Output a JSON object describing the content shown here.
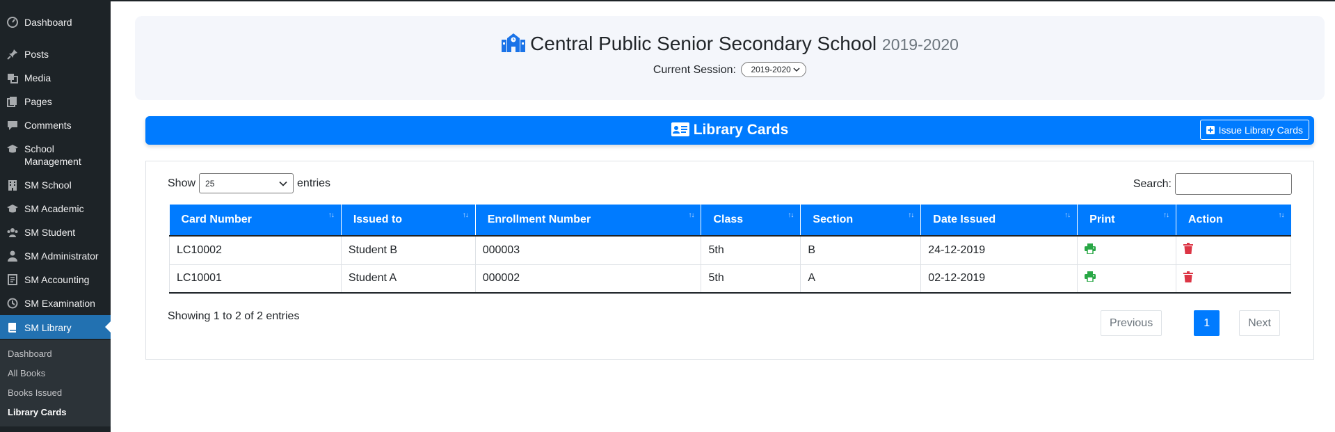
{
  "sidebar": {
    "items": [
      {
        "label": "Dashboard",
        "icon": "dashboard-icon"
      },
      {
        "label": "Posts",
        "icon": "pin-icon"
      },
      {
        "label": "Media",
        "icon": "media-icon"
      },
      {
        "label": "Pages",
        "icon": "pages-icon"
      },
      {
        "label": "Comments",
        "icon": "comment-icon"
      },
      {
        "label": "School Management",
        "icon": "graduation-cap-icon"
      },
      {
        "label": "SM School",
        "icon": "building-icon"
      },
      {
        "label": "SM Academic",
        "icon": "graduation-cap-icon"
      },
      {
        "label": "SM Student",
        "icon": "group-icon"
      },
      {
        "label": "SM Administrator",
        "icon": "user-icon"
      },
      {
        "label": "SM Accounting",
        "icon": "book-icon"
      },
      {
        "label": "SM Examination",
        "icon": "clock-icon"
      },
      {
        "label": "SM Library",
        "icon": "library-book-icon"
      }
    ],
    "submenu": [
      "Dashboard",
      "All Books",
      "Books Issued",
      "Library Cards"
    ]
  },
  "header": {
    "school_name": "Central Public Senior Secondary School",
    "session_year": "2019-2020",
    "session_label": "Current Session:",
    "session_value": "2019-2020"
  },
  "library_bar": {
    "title": "Library Cards",
    "issue_button": "Issue Library Cards"
  },
  "controls": {
    "show_label": "Show",
    "entries_value": "25",
    "entries_label": "entries",
    "search_label": "Search:",
    "search_value": ""
  },
  "table": {
    "headers": [
      "Card Number",
      "Issued to",
      "Enrollment Number",
      "Class",
      "Section",
      "Date Issued",
      "Print",
      "Action"
    ],
    "rows": [
      {
        "card": "LC10002",
        "issued_to": "Student B",
        "enrollment": "000003",
        "class": "5th",
        "section": "B",
        "date": "24-12-2019"
      },
      {
        "card": "LC10001",
        "issued_to": "Student A",
        "enrollment": "000002",
        "class": "5th",
        "section": "A",
        "date": "02-12-2019"
      }
    ]
  },
  "footer": {
    "info": "Showing 1 to 2 of 2 entries",
    "previous": "Previous",
    "page": "1",
    "next": "Next"
  },
  "colors": {
    "primary": "#007bff",
    "sidebar": "#1d2327",
    "active_menu": "#2271b1",
    "print_icon": "#28a745",
    "delete_icon": "#dc3545"
  }
}
